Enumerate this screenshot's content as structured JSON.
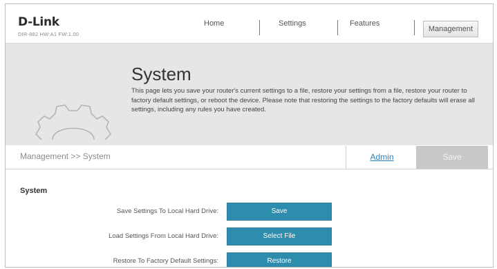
{
  "header": {
    "logo": "D-Link",
    "model": "DIR-882 HW:A1 FW:1.00",
    "nav": [
      "Home",
      "Settings",
      "Features",
      "Management"
    ]
  },
  "banner": {
    "title": "System",
    "description": "This page lets you save your router's current settings to a file, restore your settings from a file, restore your router to factory default settings, or reboot the device. Please note that restoring the settings to the factory defaults will erase all settings, including any rules you have created."
  },
  "breadcrumb": "Management >> System",
  "actions": {
    "admin": "Admin",
    "save": "Save"
  },
  "section_title": "System",
  "rows": [
    {
      "label": "Save Settings To Local Hard Drive:",
      "button": "Save"
    },
    {
      "label": "Load Settings From Local Hard Drive:",
      "button": "Select File"
    },
    {
      "label": "Restore To Factory Default Settings:",
      "button": "Restore"
    }
  ],
  "colors": {
    "accent": "#2e8dad",
    "link": "#2a7fb3",
    "banner": "#e6e6e6"
  }
}
